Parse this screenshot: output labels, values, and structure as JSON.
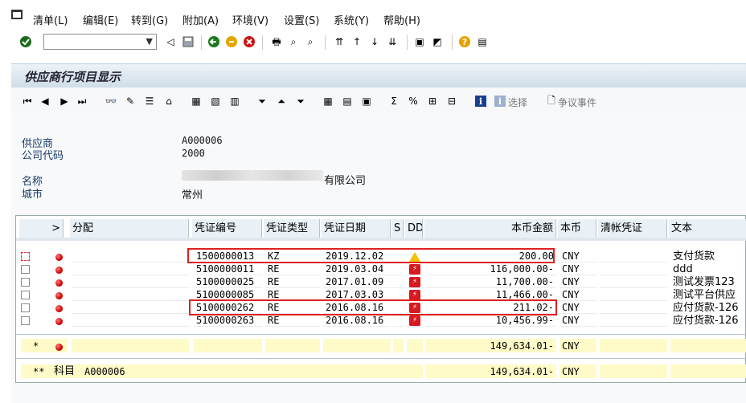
{
  "menu": {
    "items": [
      "清单(L)",
      "编辑(E)",
      "转到(G)",
      "附加(A)",
      "环境(V)",
      "设置(S)",
      "系统(Y)",
      "帮助(H)"
    ]
  },
  "title": "供应商行项目显示",
  "toolbar": {
    "select_label": "选择",
    "dispute_label": "争议事件"
  },
  "header": {
    "vendor_label": "供应商",
    "vendor_value": "A000006",
    "company_label": "公司代码",
    "company_value": "2000",
    "name_label": "名称",
    "name_suffix": "有限公司",
    "city_label": "城市",
    "city_value": "常州"
  },
  "grid": {
    "columns": {
      "expand": ">",
      "assignment": "分配",
      "doc_no": "凭证编号",
      "doc_type": "凭证类型",
      "doc_date": "凭证日期",
      "s": "S",
      "dd": "DD",
      "amount": "本币金额",
      "currency": "本币",
      "clearing": "清帐凭证",
      "text": "文本"
    },
    "rows": [
      {
        "doc_no": "1500000013",
        "type": "KZ",
        "date": "2019.12.02",
        "dd": "warning",
        "amount": "200.00",
        "currency": "CNY",
        "text": "支付货款"
      },
      {
        "doc_no": "5100000011",
        "type": "RE",
        "date": "2019.03.04",
        "dd": "due",
        "amount": "116,000.00-",
        "currency": "CNY",
        "text": "ddd"
      },
      {
        "doc_no": "5100000025",
        "type": "RE",
        "date": "2017.01.09",
        "dd": "due",
        "amount": "11,700.00-",
        "currency": "CNY",
        "text": "测试发票123"
      },
      {
        "doc_no": "5100000085",
        "type": "RE",
        "date": "2017.03.03",
        "dd": "due",
        "amount": "11,466.00-",
        "currency": "CNY",
        "text": "测试平台供应"
      },
      {
        "doc_no": "5100000262",
        "type": "RE",
        "date": "2016.08.16",
        "dd": "due",
        "amount": "211.02-",
        "currency": "CNY",
        "text": "应付货款-126"
      },
      {
        "doc_no": "5100000263",
        "type": "RE",
        "date": "2016.08.16",
        "dd": "due",
        "amount": "10,456.99-",
        "currency": "CNY",
        "text": "应付货款-126"
      }
    ],
    "subtotal": {
      "marker": "*",
      "amount": "149,634.01-",
      "currency": "CNY"
    },
    "total": {
      "marker": "**",
      "label": "科目",
      "account": "A000006",
      "amount": "149,634.01-",
      "currency": "CNY"
    }
  },
  "colors": {
    "highlight_box": "#e02020",
    "status_red": "#d10000",
    "total_row": "#fffbc8",
    "title_band": "#cfdde8"
  }
}
